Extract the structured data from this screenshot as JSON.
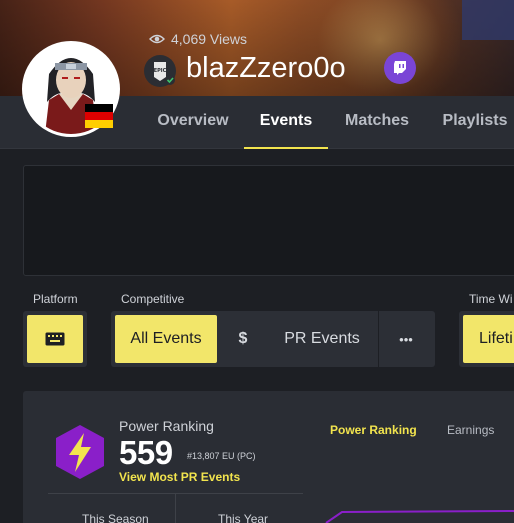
{
  "profile": {
    "views_count": "4,069 Views",
    "username": "blazZzero0o",
    "platform_badge": "EPIC GAMES",
    "country_flag_icon": "germany-flag-icon",
    "twitch_icon": "twitch-icon",
    "eye_icon": "eye-icon"
  },
  "nav": {
    "tabs": [
      {
        "label": "Overview"
      },
      {
        "label": "Events"
      },
      {
        "label": "Matches"
      },
      {
        "label": "Playlists"
      }
    ],
    "active": "Events"
  },
  "filters": {
    "platform_label": "Platform",
    "platform_icon": "keyboard-icon",
    "competitive_label": "Competitive",
    "all_events": "All Events",
    "dollar": "$",
    "pr_events": "PR Events",
    "more": "•••",
    "time_label": "Time Wi",
    "time_value": "Lifeti"
  },
  "power_ranking": {
    "label": "Power Ranking",
    "value": "559",
    "rank": "#13,807 EU (PC)",
    "link": "View Most PR Events",
    "this_season": "This Season",
    "this_year": "This Year",
    "icon": "lightning-hex-icon"
  },
  "chart_tabs": {
    "power_ranking": "Power Ranking",
    "earnings": "Earnings"
  },
  "colors": {
    "accent": "#f2e44e",
    "twitch": "#7a45d6",
    "hex": "#8a1fc9",
    "chart_line": "#8a1fc9"
  }
}
